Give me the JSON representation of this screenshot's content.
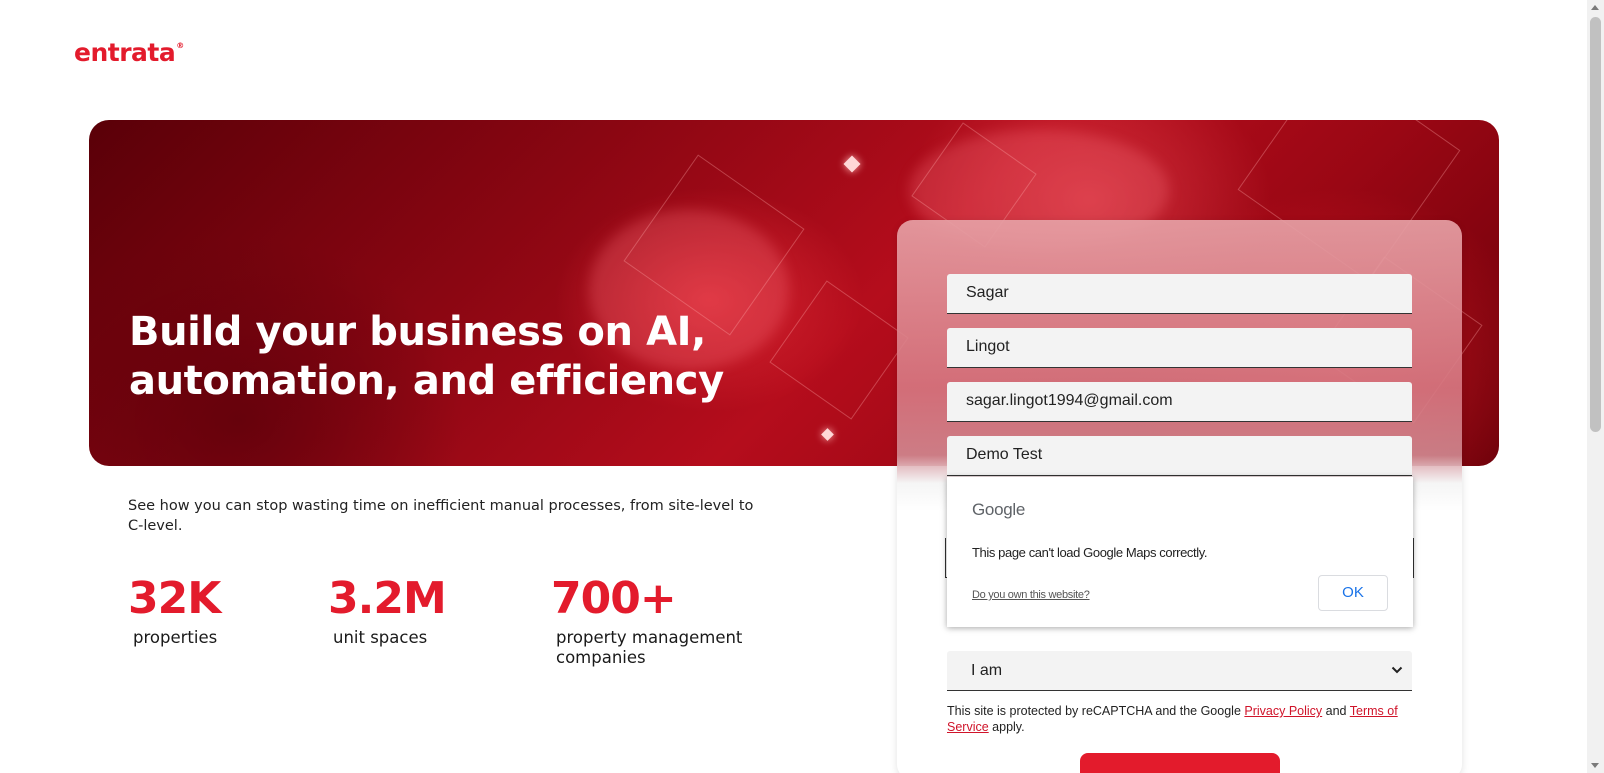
{
  "brand": {
    "logo_text": "entrata",
    "logo_mark": "®",
    "accent": "#e31b2c"
  },
  "hero": {
    "title_line1": "Build your business on AI,",
    "title_line2": "automation, and efficiency"
  },
  "subtitle": "See how you can stop wasting time on inefficient manual processes, from site-level to C-level.",
  "stats": [
    {
      "number": "32K",
      "label": "properties"
    },
    {
      "number": "3.2M",
      "label": "unit spaces"
    },
    {
      "number": "700+",
      "label_line1": "property management",
      "label_line2": "companies"
    }
  ],
  "form": {
    "first_name": "Sagar",
    "last_name": "Lingot",
    "email": "sagar.lingot1994@gmail.com",
    "company": "Demo Test",
    "role_select": "I am",
    "recaptcha_prefix": "This site is protected by reCAPTCHA and the Google",
    "privacy_link": "Privacy Policy",
    "and_text": "and",
    "terms_link": "Terms of Service",
    "suffix": "apply."
  },
  "google_maps_dialog": {
    "logo": "Google",
    "message": "This page can't load Google Maps correctly.",
    "own_link": "Do you own this website?",
    "ok_label": "OK"
  }
}
